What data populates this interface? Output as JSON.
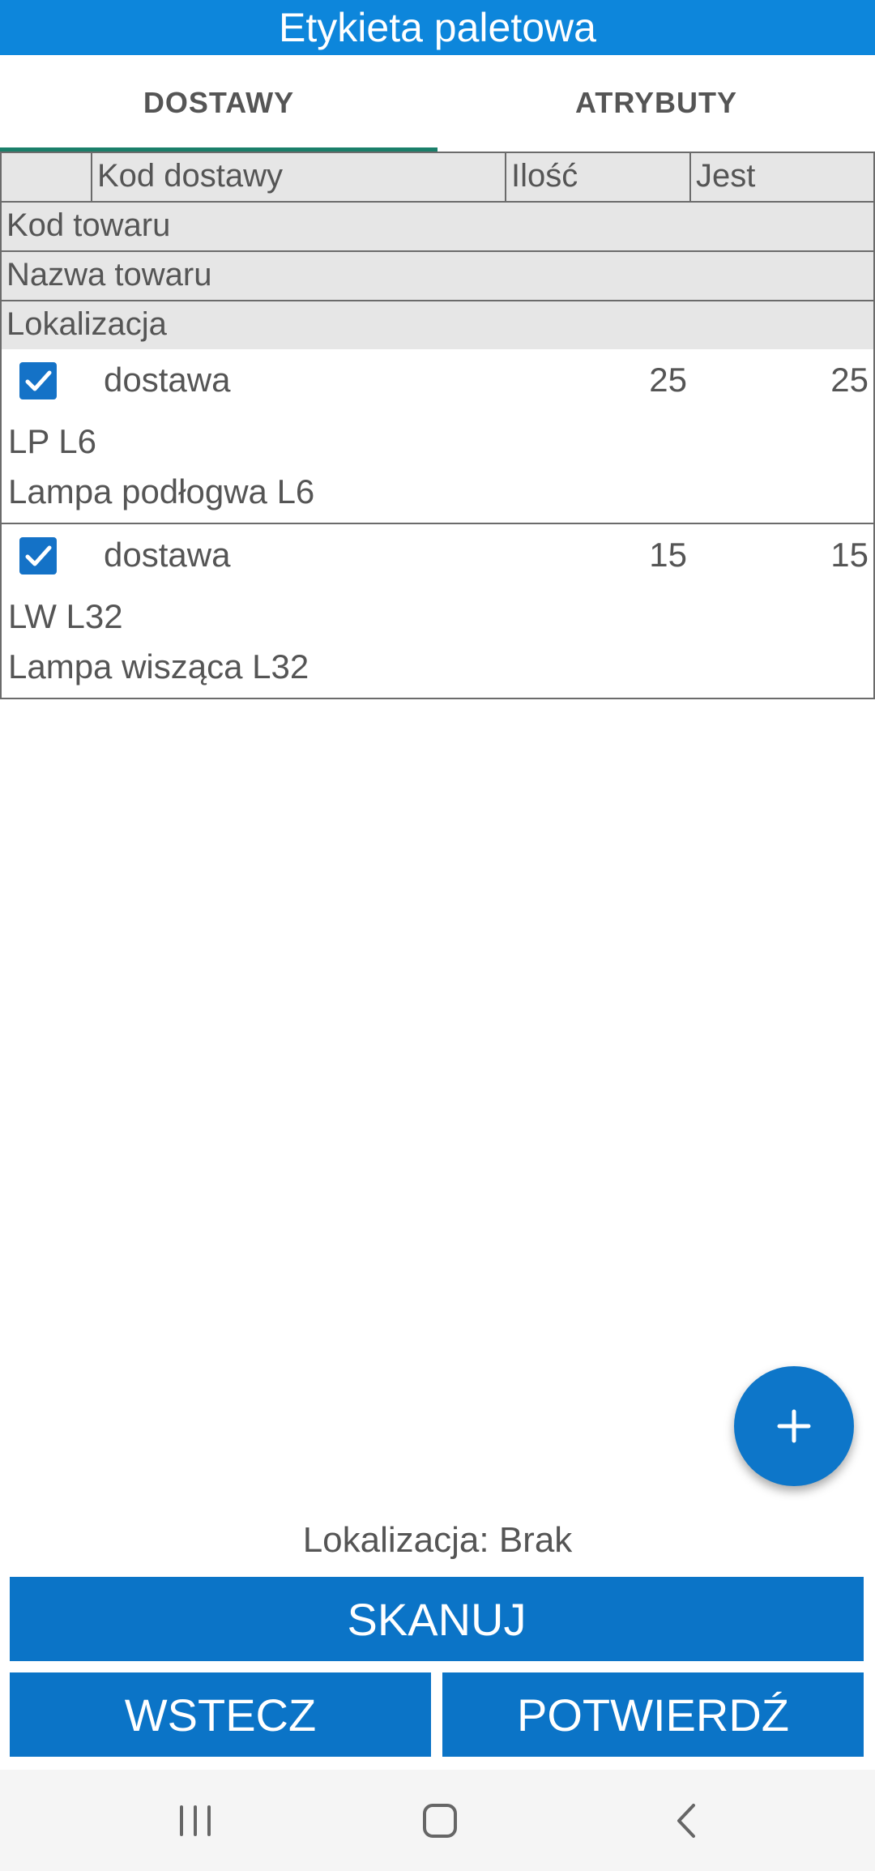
{
  "app": {
    "title": "Etykieta paletowa"
  },
  "tabs": [
    {
      "label": "DOSTAWY",
      "active": true
    },
    {
      "label": "ATRYBUTY",
      "active": false
    }
  ],
  "table": {
    "header": {
      "col_code": "Kod dostawy",
      "col_qty": "Ilość",
      "col_have": "Jest"
    },
    "header_rows": [
      "Kod towaru",
      "Nazwa towaru",
      "Lokalizacja"
    ],
    "rows": [
      {
        "checked": true,
        "code": "dostawa",
        "qty": "25",
        "have": "25",
        "goods_code": "LP L6",
        "goods_name": "Lampa podłogwa L6"
      },
      {
        "checked": true,
        "code": "dostawa",
        "qty": "15",
        "have": "15",
        "goods_code": "LW L32",
        "goods_name": "Lampa wisząca L32"
      }
    ]
  },
  "fab": {
    "icon": "plus-icon"
  },
  "status": {
    "location": "Lokalizacja: Brak"
  },
  "buttons": {
    "scan": "SKANUJ",
    "back": "WSTECZ",
    "confirm": "POTWIERDŹ"
  },
  "navbar": {
    "icons": [
      "recent-apps-icon",
      "home-icon",
      "back-icon"
    ]
  },
  "colors": {
    "primary": "#0d86db",
    "button": "#0b74c7",
    "tab_indicator": "#1a7f6a",
    "header_bg": "#e6e6e6"
  }
}
